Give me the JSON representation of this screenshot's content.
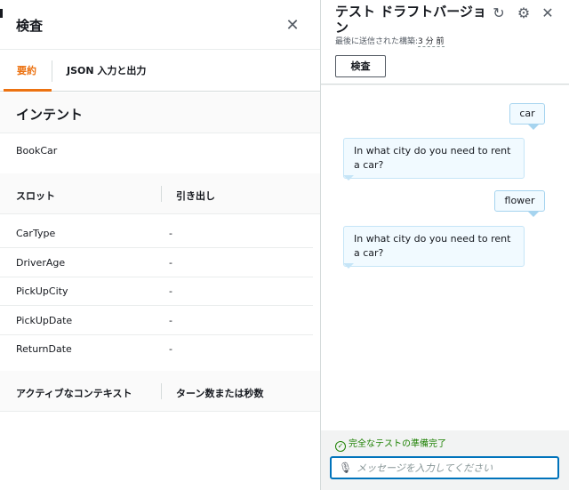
{
  "inspect_panel": {
    "title": "検査",
    "close_icon": "close-icon",
    "tabs": [
      {
        "label": "要約",
        "active": true
      },
      {
        "label": "JSON 入力と出力",
        "active": false
      }
    ],
    "intent_section": {
      "title": "インテント",
      "value": "BookCar"
    },
    "slots": {
      "header_slot": "スロット",
      "header_value": "引き出し",
      "rows": [
        {
          "name": "CarType",
          "value": "-"
        },
        {
          "name": "DriverAge",
          "value": "-"
        },
        {
          "name": "PickUpCity",
          "value": "-"
        },
        {
          "name": "PickUpDate",
          "value": "-"
        },
        {
          "name": "ReturnDate",
          "value": "-"
        }
      ]
    },
    "contexts": {
      "header_context": "アクティブなコンテキスト",
      "header_turns": "ターン数または秒数"
    }
  },
  "test_panel": {
    "title": "テスト ドラフトバージョン",
    "subtitle_prefix": "最後に送信された構築:",
    "subtitle_time": "3 分 前",
    "inspect_button": "検査",
    "icons": [
      "refresh-icon",
      "gear-icon",
      "close-icon"
    ],
    "messages": [
      {
        "from": "user",
        "text": "car"
      },
      {
        "from": "bot",
        "text": "In what city do you need to rent a car?"
      },
      {
        "from": "user",
        "text": "flower"
      },
      {
        "from": "bot",
        "text": "In what city do you need to rent a car?"
      }
    ],
    "status": "完全なテストの準備完了",
    "input": {
      "placeholder": "メッセージを入力してください",
      "value": ""
    }
  },
  "colors": {
    "accent": "#ec7211",
    "success": "#1d8102",
    "focus": "#0073bb",
    "bubble_bg": "#f1faff"
  }
}
